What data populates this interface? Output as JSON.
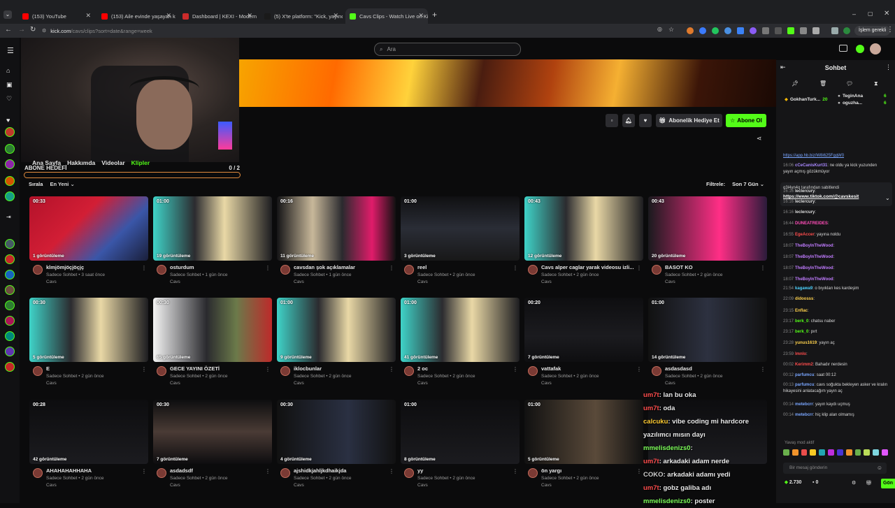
{
  "browser": {
    "tabs": [
      {
        "label": "(153) YouTube",
        "color": "#ff0000"
      },
      {
        "label": "(153) Aile evinde yaşayan kadı",
        "color": "#ff0000"
      },
      {
        "label": "Dashboard | KEXI - Modern Str",
        "color": "#cc2b2b"
      },
      {
        "label": "(5) X'te platform: \"Kick, yayıncıla",
        "color": "#1a1a1a"
      },
      {
        "label": "Cavs Clips - Watch Live on Kick",
        "color": "#53fc18"
      }
    ],
    "url_host": "kick.com",
    "url_path": "/cavs/clips?sort=date&range=week",
    "profile_label": "İşlem gerekli"
  },
  "kick": {
    "search_placeholder": "Ara",
    "channel_tabs": [
      "Ana Sayfa",
      "Hakkımda",
      "Videolar",
      "Klipler"
    ],
    "sub_goal": {
      "label": "ABONE HEDEFİ",
      "progress": "0 / 2",
      "fraction": 0
    },
    "gift_button": "Abonelik Hediye Et",
    "subscribe_button": "Abone Ol",
    "sort": {
      "label": "Sırala",
      "value": "En Yeni"
    },
    "filter": {
      "label": "Filtrele:",
      "value": "Son 7 Gün"
    },
    "clip_meta_channel": "Cavs",
    "clips": [
      {
        "dur": "00:33",
        "views": "1 görüntüleme",
        "title": "klmjömjöçjöçjç",
        "meta": "Sadece Sohbet • 3 saat önce"
      },
      {
        "dur": "01:00",
        "views": "19 görüntüleme",
        "title": "osturdum",
        "meta": "Sadece Sohbet • 1 gün önce"
      },
      {
        "dur": "00:16",
        "views": "11 görüntüleme",
        "title": "cavsdan şok açıklamalar",
        "meta": "Sadece Sohbet • 1 gün önce"
      },
      {
        "dur": "01:00",
        "views": "3 görüntüleme",
        "title": "reel",
        "meta": "Sadece Sohbet • 2 gün önce"
      },
      {
        "dur": "00:43",
        "views": "12 görüntüleme",
        "title": "Cavs alper caglar yarak videosu izli...",
        "meta": "Sadece Sohbet • 2 gün önce"
      },
      {
        "dur": "00:43",
        "views": "20 görüntüleme",
        "title": "BASOT KO",
        "meta": "Sadece Sohbet • 2 gün önce"
      },
      {
        "dur": "00:30",
        "views": "5 görüntüleme",
        "title": "E",
        "meta": "Sadece Sohbet • 2 gün önce"
      },
      {
        "dur": "00:30",
        "views": "65 görüntüleme",
        "title": "GECE YAYINI ÖZETİ",
        "meta": "Sadece Sohbet • 2 gün önce"
      },
      {
        "dur": "01:00",
        "views": "9 görüntüleme",
        "title": "iklocbunlar",
        "meta": "Sadece Sohbet • 2 gün önce"
      },
      {
        "dur": "01:00",
        "views": "41 görüntüleme",
        "title": "2 oc",
        "meta": "Sadece Sohbet • 2 gün önce"
      },
      {
        "dur": "00:20",
        "views": "7 görüntüleme",
        "title": "vattafak",
        "meta": "Sadece Sohbet • 2 gün önce"
      },
      {
        "dur": "01:00",
        "views": "14 görüntüleme",
        "title": "asdasdasd",
        "meta": "Sadece Sohbet • 2 gün önce"
      },
      {
        "dur": "00:28",
        "views": "42 görüntüleme",
        "title": "AHAHAHAHHAHA",
        "meta": "Sadece Sohbet • 2 gün önce"
      },
      {
        "dur": "00:30",
        "views": "7 görüntüleme",
        "title": "asdadsdf",
        "meta": "Sadece Sohbet • 2 gün önce"
      },
      {
        "dur": "00:30",
        "views": "4 görüntüleme",
        "title": "ajshidkjahljkdhaikjda",
        "meta": "Sadece Sohbet • 2 gün önce"
      },
      {
        "dur": "01:00",
        "views": "8 görüntüleme",
        "title": "yy",
        "meta": "Sadece Sohbet • 2 gün önce"
      },
      {
        "dur": "01:00",
        "views": "5 görüntüleme",
        "title": "ön yargı",
        "meta": "Sadece Sohbet • 2 gün önce"
      },
      {
        "dur": "",
        "views": "",
        "title": "",
        "meta": ""
      }
    ]
  },
  "overlay_chat": [
    {
      "user": "um7t",
      "text": ": lan bu oka",
      "color": "#ff4d4d"
    },
    {
      "user": "um7t",
      "text": ": oda",
      "color": "#ff4d4d"
    },
    {
      "user": "calcuku",
      "text": ": vibe coding mi hardcore yazılımcı mısın dayı",
      "color": "#ffcc33"
    },
    {
      "user": "mmelisdenizs0",
      "text": ":",
      "color": "#7dff5a"
    },
    {
      "user": "um7t",
      "text": ": arkadaki adam nerde",
      "color": "#ff4d4d"
    },
    {
      "user": "COKO",
      "text": ": arkadaki adamı yedi",
      "color": "#cccccc"
    },
    {
      "user": "um7t",
      "text": ": gobz galiba adı",
      "color": "#ff4d4d"
    },
    {
      "user": "mmelisdenizs0",
      "text": ": poster",
      "color": "#7dff5a"
    }
  ],
  "chat": {
    "title": "Sohbet",
    "top_gifters": [
      {
        "name": "GokhanTurk...",
        "count": "20"
      },
      {
        "name": "TeginAna",
        "count": "6"
      },
      {
        "name": "oguzha...",
        "count": "6"
      }
    ],
    "pinned_by": "q3l4yn4q tarafından sabitlendi",
    "pinned_link": "https://www.tiktok.com/@cavskesit",
    "messages": [
      {
        "time": "",
        "user": "",
        "text": "https://app.hb.biz/W8i625FggW0",
        "color": "#7aa6ff"
      },
      {
        "time": "16:06",
        "user": "cCeCanisKurt31",
        "text": ": ne oldu ya kick yuzunden yayın açmış gözükmüyor",
        "color": "#a988ff"
      },
      {
        "time": "16:16",
        "user": "leclercury",
        "text": ":",
        "color": "#dddddd"
      },
      {
        "time": "16:16",
        "user": "leclercury",
        "text": ":",
        "color": "#dddddd"
      },
      {
        "time": "16:16",
        "user": "leclercury",
        "text": ":",
        "color": "#dddddd"
      },
      {
        "time": "16:44",
        "user": "DUNEATREIDES",
        "text": ":",
        "color": "#ff4db8"
      },
      {
        "time": "16:55",
        "user": "EgeAccer",
        "text": ": yayına noldu",
        "color": "#ff4d4d"
      },
      {
        "time": "18:07",
        "user": "TheBoyInTheWood",
        "text": ":",
        "color": "#c07bff"
      },
      {
        "time": "18:07",
        "user": "TheBoyInTheWood",
        "text": ":",
        "color": "#c07bff"
      },
      {
        "time": "18:07",
        "user": "TheBoyInTheWood",
        "text": ":",
        "color": "#c07bff"
      },
      {
        "time": "18:07",
        "user": "TheBoyInTheWood",
        "text": ":",
        "color": "#c07bff"
      },
      {
        "time": "21:54",
        "user": "kagawa9",
        "text": ": o bıyıkları kes kardeşim",
        "color": "#4dd2ff"
      },
      {
        "time": "22:09",
        "user": "didoosss",
        "text": ":",
        "color": "#ffd24d"
      },
      {
        "time": "23:15",
        "user": "Enflac",
        "text": ":",
        "color": "#ffd24d"
      },
      {
        "time": "23:17",
        "user": "berk_0",
        "text": ": chatsu naber",
        "color": "#53fc18"
      },
      {
        "time": "23:17",
        "user": "berk_0",
        "text": ": pırt",
        "color": "#53fc18"
      },
      {
        "time": "23:28",
        "user": "yunus1619",
        "text": ": yayın aç",
        "color": "#ffd24d"
      },
      {
        "time": "23:59",
        "user": "lmnlo",
        "text": ":",
        "color": "#ff4d4d"
      },
      {
        "time": "00:02",
        "user": "Kerimm2",
        "text": ": Bahadır nerdesin",
        "color": "#ff4d4d"
      },
      {
        "time": "00:12",
        "user": "parfumcu",
        "text": ": saat 00:12",
        "color": "#7aa6ff"
      },
      {
        "time": "00:13",
        "user": "parfumcu",
        "text": ": cavs soğukta bekleyen asker ve kralın hikayesini anlatacağım yayın aç",
        "color": "#7aa6ff"
      },
      {
        "time": "00:14",
        "user": "metebcrr",
        "text": ": yayın kaydı uçmuş",
        "color": "#7aa6ff"
      },
      {
        "time": "00:14",
        "user": "metebcrr",
        "text": ": hiç klip alan olmamış",
        "color": "#7aa6ff"
      }
    ],
    "slow_mode": "Yavaş mod aktif",
    "input_placeholder": "Bir mesaj gönderin",
    "points": "2.730",
    "count": "0",
    "send_label": "Gön"
  }
}
